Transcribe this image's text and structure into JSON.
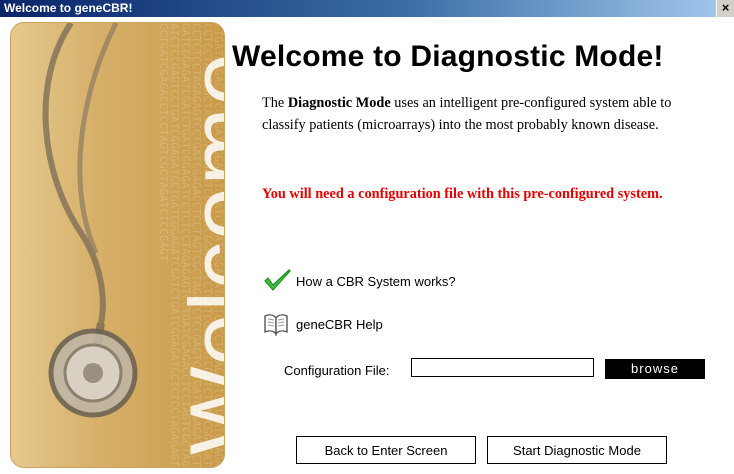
{
  "window": {
    "title": "Welcome to geneCBR!",
    "close_label": "×"
  },
  "sidebar": {
    "welcome_text": "Welcome",
    "dna_sequence": "CTGATCGGAGATCCTGATCGGAGATCGATCTGATCGGAGATCCTCTCCTAGAGAGTCCTGATCGAGACCTCCTAGTCGCTAGATCTCCGAGTCCTGATCGGAGATCCTGATCGGAGATCGATCTGATCGGAGATCCTCTCCTAGAGAGTCCTGATCGAGACCTCCTAGTCGCTAGATCTCCGAGTCCTGATCGGAGATCCTGATCGGAGATCGATCTGATCGGAGATCCTCTCCTAGAGAGTCCTGATCGAGACCTCCTAGTCGCTAGATCTCCGAGTCCTGATCGGAGATCCTGATCGGAGATCGATCTGATCGGAGATCCTCTCCTAGAGAGTCCTGATCGAGACCTCCTAGTCGCTAGATCTCCGAGT"
  },
  "main": {
    "headline": "Welcome to Diagnostic Mode!",
    "desc_prefix": "The ",
    "desc_bold": "Diagnostic Mode",
    "desc_suffix": " uses an intelligent pre-configured system able to classify patients (microarrays) into the most probably known disease.",
    "warning": "You will need a configuration file with this pre-configured system.",
    "link_cbr": "How a CBR System works?",
    "link_help": "geneCBR Help",
    "config_label": "Configuration File:",
    "config_value": "",
    "browse_label": "browse",
    "back_label": "Back to Enter Screen",
    "start_label": "Start Diagnostic Mode"
  },
  "colors": {
    "warning": "#e60000",
    "sidebar": "#d6b06a",
    "check": "#3fbf3f"
  },
  "icons": {
    "cbr": "checkmark-icon",
    "help": "book-icon"
  }
}
